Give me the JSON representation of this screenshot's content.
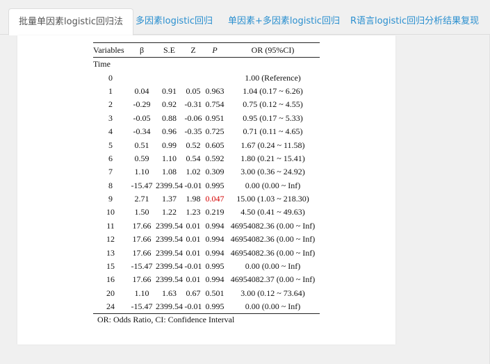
{
  "tabs": [
    {
      "label": "批量单因素logistic回归法",
      "active": true
    },
    {
      "label": "多因素logistic回归",
      "active": false
    },
    {
      "label": "单因素+多因素logistic回归",
      "active": false
    },
    {
      "label": "R语言logistic回归分析结果复现",
      "active": false
    }
  ],
  "table": {
    "headers": [
      "Variables",
      "β",
      "S.E",
      "Z",
      "P",
      "OR (95%CI)"
    ],
    "group_label": "Time",
    "rows": [
      {
        "level": "0",
        "beta": "",
        "se": "",
        "z": "",
        "p": "",
        "or": "1.00 (Reference)",
        "significant": false
      },
      {
        "level": "1",
        "beta": "0.04",
        "se": "0.91",
        "z": "0.05",
        "p": "0.963",
        "or": "1.04 (0.17 ~ 6.26)",
        "significant": false
      },
      {
        "level": "2",
        "beta": "-0.29",
        "se": "0.92",
        "z": "-0.31",
        "p": "0.754",
        "or": "0.75 (0.12 ~ 4.55)",
        "significant": false
      },
      {
        "level": "3",
        "beta": "-0.05",
        "se": "0.88",
        "z": "-0.06",
        "p": "0.951",
        "or": "0.95 (0.17 ~ 5.33)",
        "significant": false
      },
      {
        "level": "4",
        "beta": "-0.34",
        "se": "0.96",
        "z": "-0.35",
        "p": "0.725",
        "or": "0.71 (0.11 ~ 4.65)",
        "significant": false
      },
      {
        "level": "5",
        "beta": "0.51",
        "se": "0.99",
        "z": "0.52",
        "p": "0.605",
        "or": "1.67 (0.24 ~ 11.58)",
        "significant": false
      },
      {
        "level": "6",
        "beta": "0.59",
        "se": "1.10",
        "z": "0.54",
        "p": "0.592",
        "or": "1.80 (0.21 ~ 15.41)",
        "significant": false
      },
      {
        "level": "7",
        "beta": "1.10",
        "se": "1.08",
        "z": "1.02",
        "p": "0.309",
        "or": "3.00 (0.36 ~ 24.92)",
        "significant": false
      },
      {
        "level": "8",
        "beta": "-15.47",
        "se": "2399.54",
        "z": "-0.01",
        "p": "0.995",
        "or": "0.00 (0.00 ~ Inf)",
        "significant": false
      },
      {
        "level": "9",
        "beta": "2.71",
        "se": "1.37",
        "z": "1.98",
        "p": "0.047",
        "or": "15.00 (1.03 ~ 218.30)",
        "significant": true
      },
      {
        "level": "10",
        "beta": "1.50",
        "se": "1.22",
        "z": "1.23",
        "p": "0.219",
        "or": "4.50 (0.41 ~ 49.63)",
        "significant": false
      },
      {
        "level": "11",
        "beta": "17.66",
        "se": "2399.54",
        "z": "0.01",
        "p": "0.994",
        "or": "46954082.36 (0.00 ~ Inf)",
        "significant": false
      },
      {
        "level": "12",
        "beta": "17.66",
        "se": "2399.54",
        "z": "0.01",
        "p": "0.994",
        "or": "46954082.36 (0.00 ~ Inf)",
        "significant": false
      },
      {
        "level": "13",
        "beta": "17.66",
        "se": "2399.54",
        "z": "0.01",
        "p": "0.994",
        "or": "46954082.36 (0.00 ~ Inf)",
        "significant": false
      },
      {
        "level": "15",
        "beta": "-15.47",
        "se": "2399.54",
        "z": "-0.01",
        "p": "0.995",
        "or": "0.00 (0.00 ~ Inf)",
        "significant": false
      },
      {
        "level": "16",
        "beta": "17.66",
        "se": "2399.54",
        "z": "0.01",
        "p": "0.994",
        "or": "46954082.37 (0.00 ~ Inf)",
        "significant": false
      },
      {
        "level": "20",
        "beta": "1.10",
        "se": "1.63",
        "z": "0.67",
        "p": "0.501",
        "or": "3.00 (0.12 ~ 73.64)",
        "significant": false
      },
      {
        "level": "24",
        "beta": "-15.47",
        "se": "2399.54",
        "z": "-0.01",
        "p": "0.995",
        "or": "0.00 (0.00 ~ Inf)",
        "significant": false
      }
    ],
    "footnote": "OR: Odds Ratio, CI: Confidence Interval"
  },
  "colors": {
    "tab_link": "#2a8fcf",
    "tab_active_text": "#555555",
    "significant": "#d40000",
    "background": "#f0f0f0"
  }
}
